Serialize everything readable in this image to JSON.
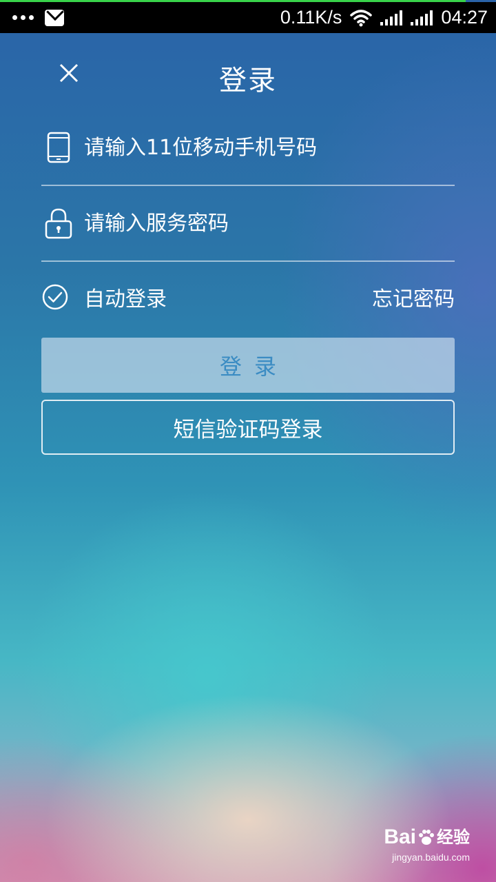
{
  "status_bar": {
    "network_speed": "0.11K/s",
    "time": "04:27",
    "icons": [
      "more-dots-icon",
      "mail-icon",
      "wifi-icon",
      "signal-icon",
      "signal-icon"
    ]
  },
  "header": {
    "title": "登录",
    "close_icon": "close-icon"
  },
  "form": {
    "phone": {
      "placeholder": "请输入11位移动手机号码",
      "value": "",
      "icon": "phone-icon"
    },
    "password": {
      "placeholder": "请输入服务密码",
      "value": "",
      "icon": "lock-icon"
    },
    "auto_login": {
      "label": "自动登录",
      "checked": true,
      "icon": "check-circle-icon"
    },
    "forgot_password": "忘记密码",
    "login_button": "登录",
    "sms_login_button": "短信验证码登录"
  },
  "watermark": {
    "brand": "Bai",
    "brand_cn": "经验",
    "url": "jingyan.baidu.com"
  },
  "colors": {
    "login_button_text": "#3b8cc3",
    "status_bar_accent": "#38d24a"
  }
}
